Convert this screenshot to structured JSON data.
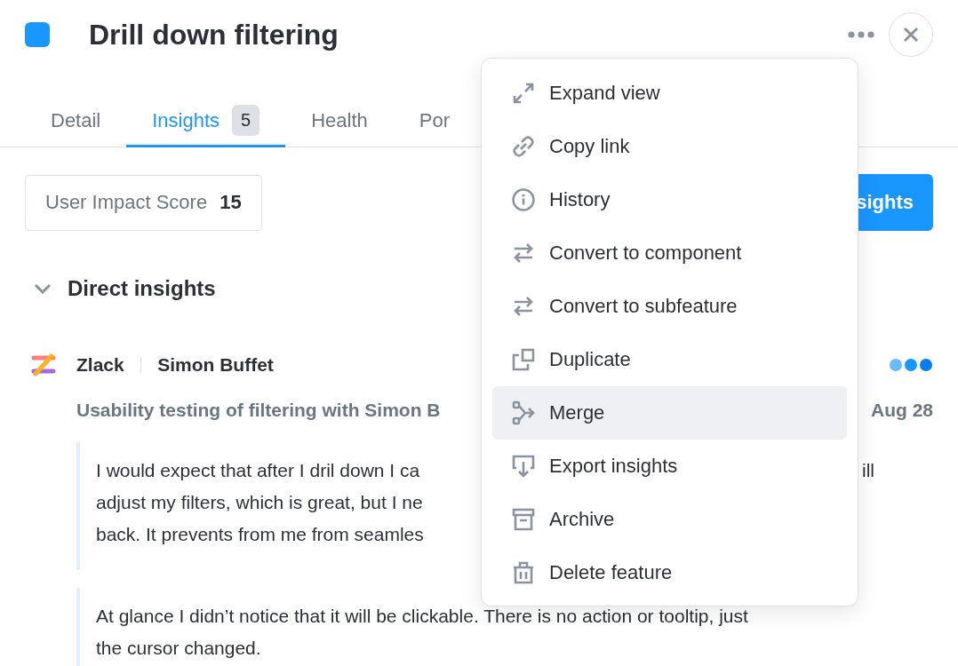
{
  "header": {
    "title": "Drill down filtering"
  },
  "tabs": [
    {
      "label": "Detail",
      "selected": false
    },
    {
      "label": "Insights",
      "badge": "5",
      "selected": true
    },
    {
      "label": "Health",
      "selected": false
    },
    {
      "label": "Por",
      "selected": false
    }
  ],
  "score": {
    "label": "User Impact Score",
    "value": "15"
  },
  "action_button": {
    "label": "sights"
  },
  "section": {
    "title": "Direct insights",
    "expanded": true
  },
  "insight": {
    "source": "Zlack",
    "author": "Simon Buffet",
    "title": "Usability testing of filtering with Simon B",
    "date": "Aug 28",
    "quotes": [
      {
        "lines": [
          {
            "text": "I would expect that after I dril down I ca",
            "overflow": "ill"
          },
          {
            "text": "adjust my filters, which is great, but I ne"
          },
          {
            "text": "back. It prevents from me from seamles"
          }
        ]
      },
      {
        "lines": [
          {
            "text": "At glance I didn’t notice that it will be clickable. There is no action or tooltip, just"
          },
          {
            "text": "the cursor changed."
          }
        ]
      }
    ]
  },
  "menu": {
    "items": [
      {
        "label": "Expand view",
        "kind": "expand",
        "highlighted": false
      },
      {
        "label": "Copy link",
        "kind": "link",
        "highlighted": false
      },
      {
        "label": "History",
        "kind": "info",
        "highlighted": false
      },
      {
        "label": "Convert to component",
        "kind": "convert",
        "highlighted": false
      },
      {
        "label": "Convert to subfeature",
        "kind": "convert",
        "highlighted": false
      },
      {
        "label": "Duplicate",
        "kind": "duplicate",
        "highlighted": false
      },
      {
        "label": "Merge",
        "kind": "merge",
        "highlighted": true
      },
      {
        "label": "Export insights",
        "kind": "export",
        "highlighted": false
      },
      {
        "label": "Archive",
        "kind": "archive",
        "highlighted": false
      },
      {
        "label": "Delete feature",
        "kind": "delete",
        "highlighted": false
      }
    ]
  }
}
